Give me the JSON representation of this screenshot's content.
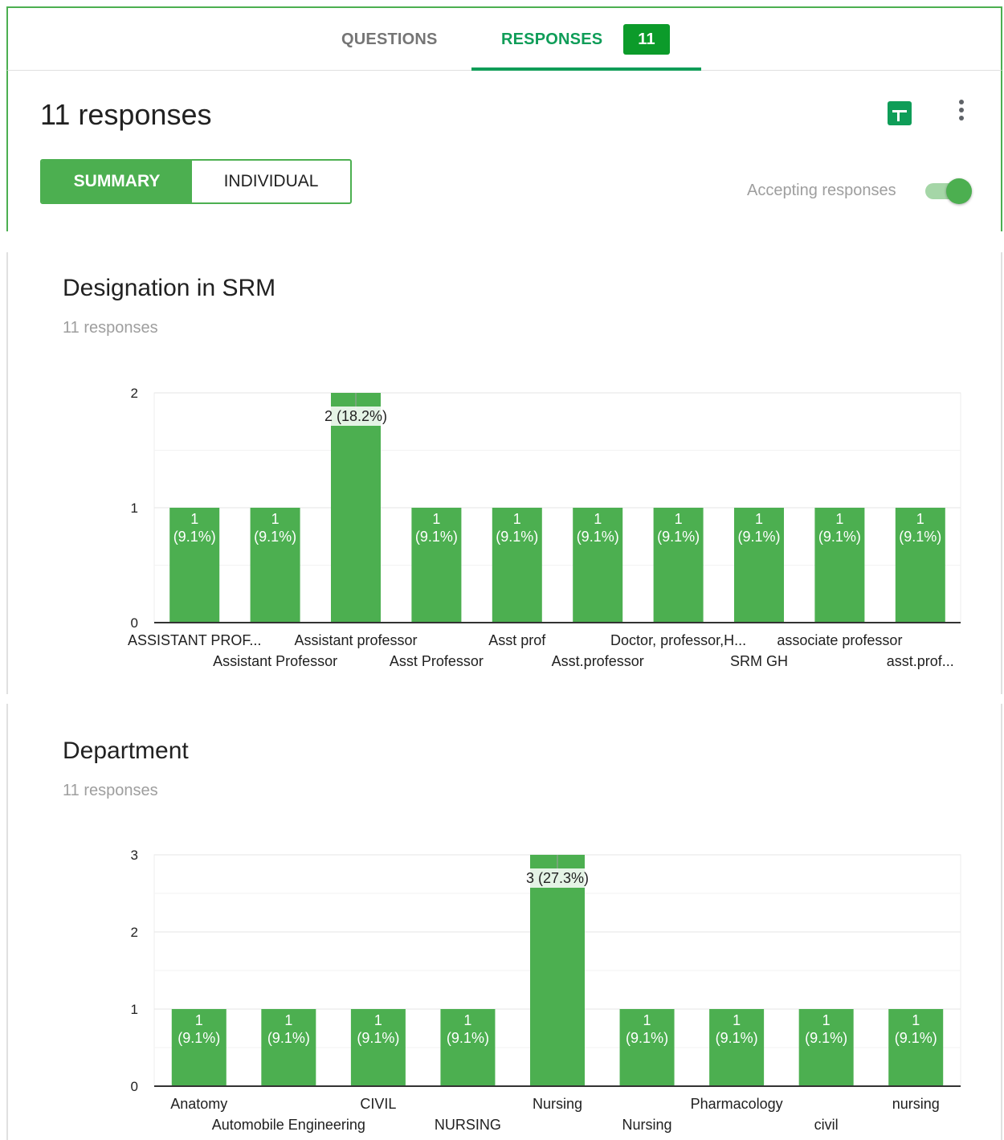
{
  "tabs": {
    "questions_label": "QUESTIONS",
    "responses_label": "RESPONSES",
    "responses_badge": "11"
  },
  "header": {
    "response_count": "11 responses",
    "summary_label": "SUMMARY",
    "individual_label": "INDIVIDUAL",
    "accepting_label": "Accepting responses",
    "accepting_on": true,
    "sheets_icon": "google-sheets-icon",
    "more_icon": "more-vert-icon"
  },
  "colors": {
    "accent": "#0f9d58",
    "bar": "#4caf50",
    "badge": "#0c9b2a"
  },
  "questions": [
    {
      "title": "Designation in SRM",
      "subtitle": "11 responses"
    },
    {
      "title": "Department",
      "subtitle": "11 responses"
    }
  ],
  "chart_data": [
    {
      "type": "bar",
      "title": "Designation in SRM",
      "ylim": [
        0,
        2
      ],
      "yticks": [
        "0",
        "1",
        "2"
      ],
      "categories": [
        "ASSISTANT PROF...",
        "Assistant Professor",
        "Assistant professor",
        "Asst Professor",
        "Asst prof",
        "Asst.professor",
        "Doctor, professor,H...",
        "SRM GH",
        "associate professor",
        "asst.prof..."
      ],
      "values": [
        1,
        1,
        2,
        1,
        1,
        1,
        1,
        1,
        1,
        1
      ],
      "data_labels": [
        [
          "1",
          "(9.1%)"
        ],
        [
          "1",
          "(9.1%)"
        ],
        [
          "2 (18.2%)"
        ],
        [
          "1",
          "(9.1%)"
        ],
        [
          "1",
          "(9.1%)"
        ],
        [
          "1",
          "(9.1%)"
        ],
        [
          "1",
          "(9.1%)"
        ],
        [
          "1",
          "(9.1%)"
        ],
        [
          "1",
          "(9.1%)"
        ],
        [
          "1",
          "(9.1%)"
        ]
      ]
    },
    {
      "type": "bar",
      "title": "Department",
      "ylim": [
        0,
        3
      ],
      "yticks": [
        "0",
        "1",
        "2",
        "3"
      ],
      "categories": [
        "Anatomy",
        "Automobile Engineering",
        "CIVIL",
        "NURSING",
        "Nursing",
        "Nursing",
        "Pharmacology",
        "civil",
        "nursing"
      ],
      "values": [
        1,
        1,
        1,
        1,
        3,
        1,
        1,
        1,
        1
      ],
      "data_labels": [
        [
          "1",
          "(9.1%)"
        ],
        [
          "1",
          "(9.1%)"
        ],
        [
          "1",
          "(9.1%)"
        ],
        [
          "1",
          "(9.1%)"
        ],
        [
          "3 (27.3%)"
        ],
        [
          "1",
          "(9.1%)"
        ],
        [
          "1",
          "(9.1%)"
        ],
        [
          "1",
          "(9.1%)"
        ],
        [
          "1",
          "(9.1%)"
        ]
      ]
    }
  ]
}
